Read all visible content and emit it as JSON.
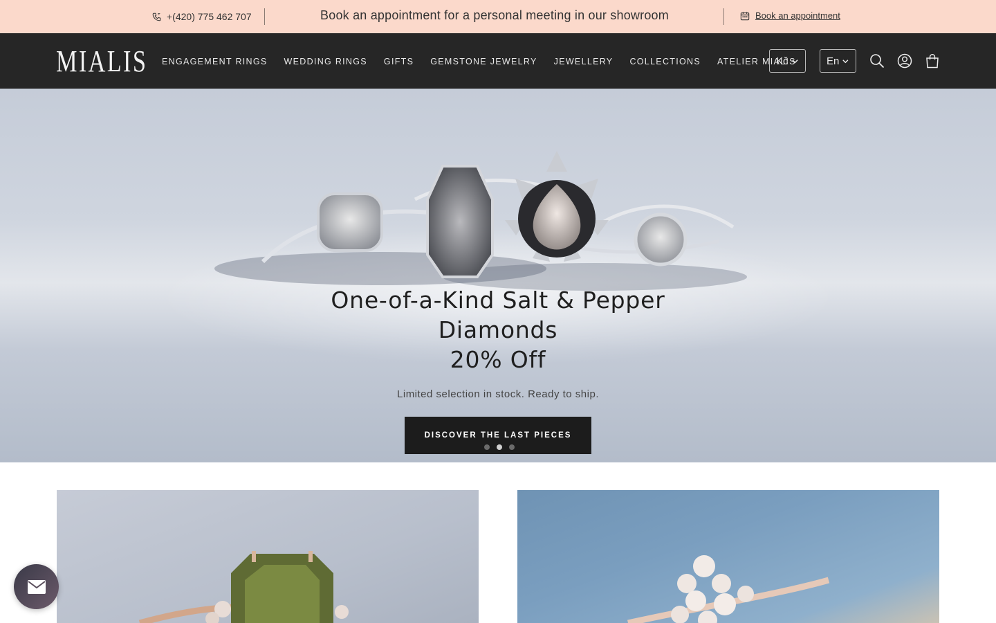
{
  "topbar": {
    "phone": "+(420) 775 462 707",
    "promo": "Book an appointment for a personal meeting in our showroom",
    "book_link": "Book an appointment",
    "background": "#fbd9cb"
  },
  "nav": {
    "logo": "MIALIS",
    "menu": [
      "ENGAGEMENT RINGS",
      "WEDDING RINGS",
      "GIFTS",
      "GEMSTONE JEWELRY",
      "JEWELLERY",
      "COLLECTIONS",
      "ATELIER MIALIS"
    ],
    "currency": "Kč",
    "language": "En",
    "icons": [
      "search-icon",
      "account-icon",
      "cart-icon"
    ],
    "background": "#262626"
  },
  "hero": {
    "title_line1": "One-of-a-Kind Salt & Pepper",
    "title_line2": "Diamonds",
    "title_line3": "20% Off",
    "subtitle": "Limited selection in stock. Ready to ship.",
    "cta": "DISCOVER THE LAST PIECES",
    "slides": 3,
    "active_slide": 2
  },
  "chat": {
    "icon": "mail-icon"
  }
}
